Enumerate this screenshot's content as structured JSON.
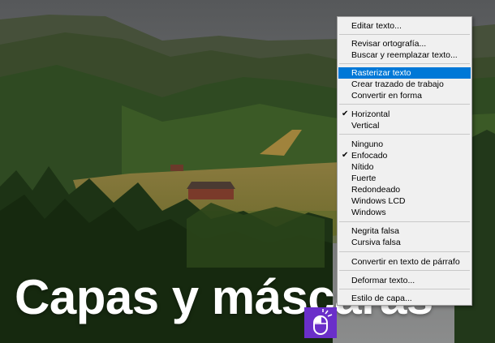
{
  "title": {
    "text": "Capas y máscaras"
  },
  "menu": {
    "items": [
      {
        "label": "Editar texto..."
      },
      {
        "label": "Revisar ortografía..."
      },
      {
        "label": "Buscar y reemplazar texto..."
      },
      {
        "label": "Rasterizar texto",
        "highlighted": true
      },
      {
        "label": "Crear trazado de trabajo"
      },
      {
        "label": "Convertir en forma"
      },
      {
        "label": "Horizontal",
        "checked": true
      },
      {
        "label": "Vertical"
      },
      {
        "label": "Ninguno"
      },
      {
        "label": "Enfocado",
        "checked": true
      },
      {
        "label": "Nítido"
      },
      {
        "label": "Fuerte"
      },
      {
        "label": "Redondeado"
      },
      {
        "label": "Windows LCD"
      },
      {
        "label": "Windows"
      },
      {
        "label": "Negrita falsa"
      },
      {
        "label": "Cursiva falsa"
      },
      {
        "label": "Convertir en texto de párrafo"
      },
      {
        "label": "Deformar texto..."
      },
      {
        "label": "Estilo de capa..."
      }
    ],
    "check_mark": "✔"
  },
  "colors": {
    "highlight": "#0078d7",
    "badge": "#6a2fc9"
  },
  "icons": {
    "badge": "mouse-click-icon"
  }
}
